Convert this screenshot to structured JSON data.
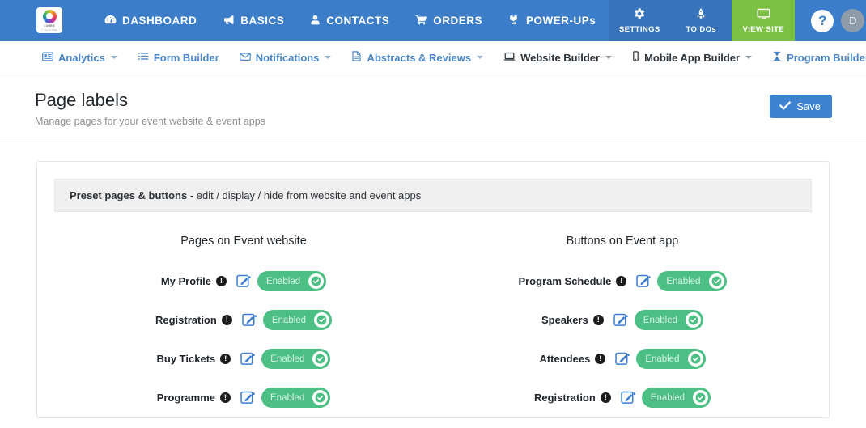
{
  "header": {
    "logo": {
      "name": "LOREM",
      "tagline": "IT SOLUTIONS"
    },
    "nav": [
      {
        "label": "DASHBOARD",
        "icon": "dashboard-icon"
      },
      {
        "label": "BASICS",
        "icon": "megaphone-icon"
      },
      {
        "label": "CONTACTS",
        "icon": "user-icon"
      },
      {
        "label": "ORDERS",
        "icon": "cart-icon"
      },
      {
        "label": "POWER-UPs",
        "icon": "puzzle-icon"
      }
    ],
    "tiles": [
      {
        "label": "SETTINGS",
        "icon": "gear-icon"
      },
      {
        "label": "TO DOs",
        "icon": "rocket-icon"
      },
      {
        "label": "VIEW SITE",
        "icon": "monitor-icon"
      }
    ],
    "help_label": "?",
    "avatar_initial": "D",
    "colors": {
      "bar": "#3b7dc8",
      "tile": "#3774bb",
      "view_site": "#7ac143"
    }
  },
  "subnav": [
    {
      "label": "Analytics",
      "icon": "analytics-icon",
      "caret": true,
      "active": false
    },
    {
      "label": "Form Builder",
      "icon": "list-icon",
      "caret": false,
      "active": false
    },
    {
      "label": "Notifications",
      "icon": "envelope-icon",
      "caret": true,
      "active": false
    },
    {
      "label": "Abstracts & Reviews",
      "icon": "document-icon",
      "caret": true,
      "active": false
    },
    {
      "label": "Website Builder",
      "icon": "laptop-icon",
      "caret": true,
      "active": true
    },
    {
      "label": "Mobile App Builder",
      "icon": "mobile-icon",
      "caret": true,
      "active": true
    },
    {
      "label": "Program Builder",
      "icon": "hourglass-icon",
      "caret": false,
      "active": false
    }
  ],
  "page": {
    "title": "Page labels",
    "subtitle": "Manage pages for your event website & event apps",
    "save_label": "Save"
  },
  "panel": {
    "heading_bold": "Preset pages & buttons",
    "heading_rest": " - edit / display / hide from website and event apps"
  },
  "columns": [
    {
      "heading": "Pages on Event website",
      "rows": [
        {
          "label": "My Profile",
          "info": "!",
          "status": "Enabled",
          "enabled": true
        },
        {
          "label": "Registration",
          "info": "!",
          "status": "Enabled",
          "enabled": true
        },
        {
          "label": "Buy Tickets",
          "info": "!",
          "status": "Enabled",
          "enabled": true
        },
        {
          "label": "Programme",
          "info": "!",
          "status": "Enabled",
          "enabled": true
        }
      ]
    },
    {
      "heading": "Buttons on Event app",
      "rows": [
        {
          "label": "Program Schedule",
          "info": "!",
          "status": "Enabled",
          "enabled": true
        },
        {
          "label": "Speakers",
          "info": "!",
          "status": "Enabled",
          "enabled": true
        },
        {
          "label": "Attendees",
          "info": "!",
          "status": "Enabled",
          "enabled": true
        },
        {
          "label": "Registration",
          "info": "!",
          "status": "Enabled",
          "enabled": true
        }
      ]
    }
  ]
}
